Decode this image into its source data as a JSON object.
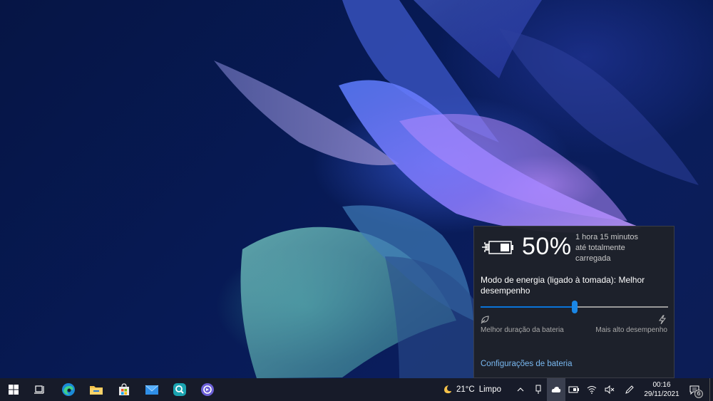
{
  "battery_flyout": {
    "percent": "50%",
    "status_line1": "1 hora 15 minutos",
    "status_line2": "até totalmente",
    "status_line3": "carregada",
    "power_mode_label": "Modo de energia (ligado à tomada): Melhor desempenho",
    "slider": {
      "value": 0.5,
      "accent": "#0a74d9"
    },
    "left_label": "Melhor duração da bateria",
    "right_label": "Mais alto desempenho",
    "settings_link": "Configurações de bateria",
    "icons": {
      "battery": "battery-charging-icon",
      "left": "leaf-icon",
      "right": "lightning-icon"
    }
  },
  "taskbar": {
    "apps": [
      {
        "name": "start-button",
        "icon": "windows-logo-icon"
      },
      {
        "name": "task-view-button",
        "icon": "task-view-icon"
      },
      {
        "name": "edge-app",
        "icon": "edge-icon"
      },
      {
        "name": "file-explorer-app",
        "icon": "folder-icon"
      },
      {
        "name": "store-app",
        "icon": "store-icon"
      },
      {
        "name": "mail-app",
        "icon": "mail-icon"
      },
      {
        "name": "search-app",
        "icon": "magnifier-app-icon"
      },
      {
        "name": "circle-app",
        "icon": "circle-arrow-icon"
      }
    ],
    "weather": {
      "temp": "21°C",
      "desc": "Limpo",
      "icon": "moon-icon"
    },
    "clock": {
      "time": "00:16",
      "date": "29/11/2021"
    },
    "notifications": "6"
  }
}
